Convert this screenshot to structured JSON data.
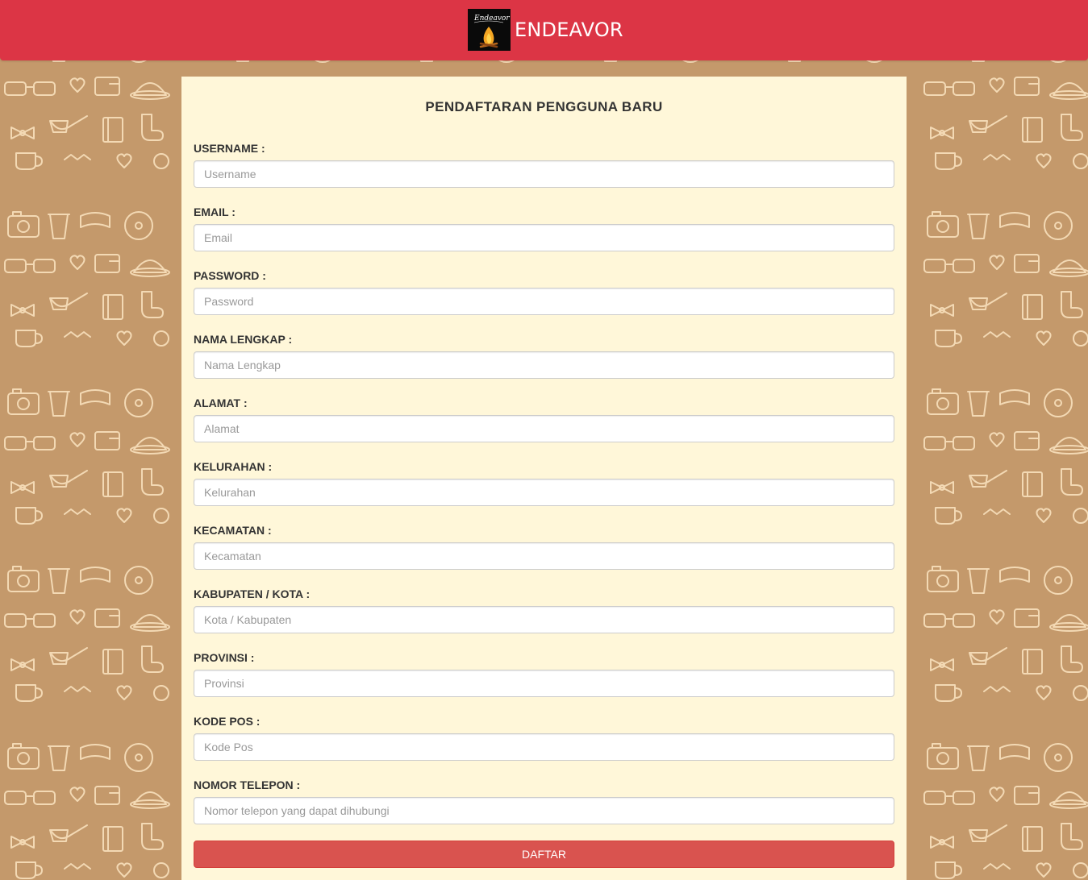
{
  "navbar": {
    "brand_name": "ENDEAVOR",
    "logo_text": "Endeavor",
    "logo_icon": "campfire-icon",
    "color": "#dc3545"
  },
  "form": {
    "title": "PENDAFTARAN PENGGUNA BARU",
    "fields": [
      {
        "label": "USERNAME :",
        "placeholder": "Username",
        "value": ""
      },
      {
        "label": "EMAIL :",
        "placeholder": "Email",
        "value": ""
      },
      {
        "label": "PASSWORD :",
        "placeholder": "Password",
        "value": ""
      },
      {
        "label": "NAMA LENGKAP :",
        "placeholder": "Nama Lengkap",
        "value": ""
      },
      {
        "label": "ALAMAT :",
        "placeholder": "Alamat",
        "value": ""
      },
      {
        "label": "KELURAHAN :",
        "placeholder": "Kelurahan",
        "value": ""
      },
      {
        "label": "KECAMATAN :",
        "placeholder": "Kecamatan",
        "value": ""
      },
      {
        "label": "KABUPATEN / KOTA :",
        "placeholder": "Kota / Kabupaten",
        "value": ""
      },
      {
        "label": "PROVINSI :",
        "placeholder": "Provinsi",
        "value": ""
      },
      {
        "label": "KODE POS :",
        "placeholder": "Kode Pos",
        "value": ""
      },
      {
        "label": "NOMOR TELEPON :",
        "placeholder": "Nomor telepon yang dapat dihubungi",
        "value": ""
      }
    ],
    "submit_label": "DAFTAR"
  },
  "colors": {
    "page_background": "#c4996b",
    "panel_background": "#fff7d9",
    "button": "#d9534f"
  }
}
